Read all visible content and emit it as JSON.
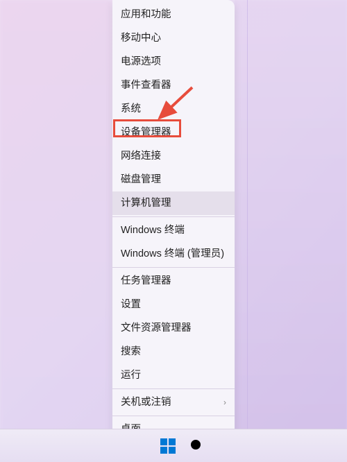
{
  "menu": {
    "groups": [
      [
        {
          "label": "应用和功能",
          "name": "menu-item-apps-and-features"
        },
        {
          "label": "移动中心",
          "name": "menu-item-mobility-center"
        },
        {
          "label": "电源选项",
          "name": "menu-item-power-options"
        },
        {
          "label": "事件查看器",
          "name": "menu-item-event-viewer"
        },
        {
          "label": "系统",
          "name": "menu-item-system"
        },
        {
          "label": "设备管理器",
          "name": "menu-item-device-manager",
          "annotated": true
        },
        {
          "label": "网络连接",
          "name": "menu-item-network-connections"
        },
        {
          "label": "磁盘管理",
          "name": "menu-item-disk-management"
        },
        {
          "label": "计算机管理",
          "name": "menu-item-computer-management",
          "hovered": true
        }
      ],
      [
        {
          "label": "Windows 终端",
          "name": "menu-item-windows-terminal"
        },
        {
          "label": "Windows 终端 (管理员)",
          "name": "menu-item-windows-terminal-admin"
        }
      ],
      [
        {
          "label": "任务管理器",
          "name": "menu-item-task-manager"
        },
        {
          "label": "设置",
          "name": "menu-item-settings"
        },
        {
          "label": "文件资源管理器",
          "name": "menu-item-file-explorer"
        },
        {
          "label": "搜索",
          "name": "menu-item-search"
        },
        {
          "label": "运行",
          "name": "menu-item-run"
        }
      ],
      [
        {
          "label": "关机或注销",
          "name": "menu-item-shutdown-signout",
          "submenu": true
        }
      ],
      [
        {
          "label": "桌面",
          "name": "menu-item-desktop"
        }
      ]
    ]
  },
  "annotation": {
    "color": "#e74c3c"
  }
}
